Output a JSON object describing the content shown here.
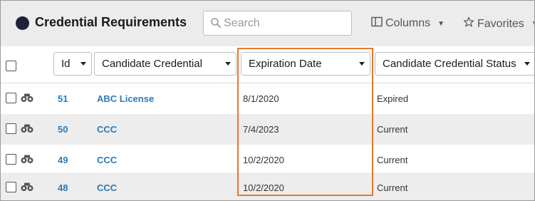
{
  "header": {
    "title": "Credential Requirements",
    "search_placeholder": "Search",
    "columns_label": "Columns",
    "favorites_label": "Favorites"
  },
  "columns": {
    "id": "Id",
    "candidate_credential": "Candidate Credential",
    "expiration_date": "Expiration Date",
    "status": "Candidate Credential Status"
  },
  "rows": [
    {
      "id": "51",
      "credential": "ABC License",
      "expiration": "8/1/2020",
      "status": "Expired"
    },
    {
      "id": "50",
      "credential": "CCC",
      "expiration": "7/4/2023",
      "status": "Current"
    },
    {
      "id": "49",
      "credential": "CCC",
      "expiration": "10/2/2020",
      "status": "Current"
    },
    {
      "id": "48",
      "credential": "CCC",
      "expiration": "10/2/2020",
      "status": "Current"
    }
  ],
  "colors": {
    "link": "#2a7ab8",
    "highlight": "#e8772e",
    "dot": "#1e2238"
  }
}
